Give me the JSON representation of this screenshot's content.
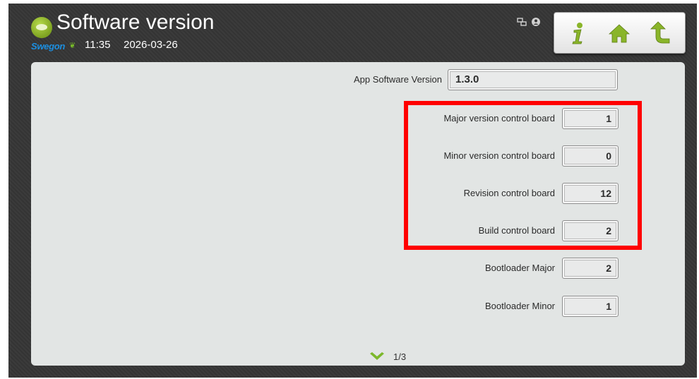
{
  "header": {
    "title": "Software version",
    "brand": "Swegon",
    "time": "11:35",
    "date": "2026-03-26"
  },
  "toolbar": {
    "icons": [
      "info-icon",
      "home-icon",
      "back-icon"
    ]
  },
  "status_icons": [
    "network-icon",
    "user-icon"
  ],
  "fields": {
    "app_software_version": {
      "label": "App Software Version",
      "value": "1.3.0"
    },
    "major_version": {
      "label": "Major version control board",
      "value": "1"
    },
    "minor_version": {
      "label": "Minor version control board",
      "value": "0"
    },
    "revision": {
      "label": "Revision control board",
      "value": "12"
    },
    "build": {
      "label": "Build control board",
      "value": "2"
    },
    "bootloader_major": {
      "label": "Bootloader Major",
      "value": "2"
    },
    "bootloader_minor": {
      "label": "Bootloader Minor",
      "value": "1"
    }
  },
  "pager": {
    "text": "1/3"
  },
  "colors": {
    "highlight": "#ff0000",
    "accent_green": "#7ea321",
    "brand_blue": "#1c8fe0",
    "header_bg": "#363636",
    "panel_bg": "#e2e5e4"
  }
}
